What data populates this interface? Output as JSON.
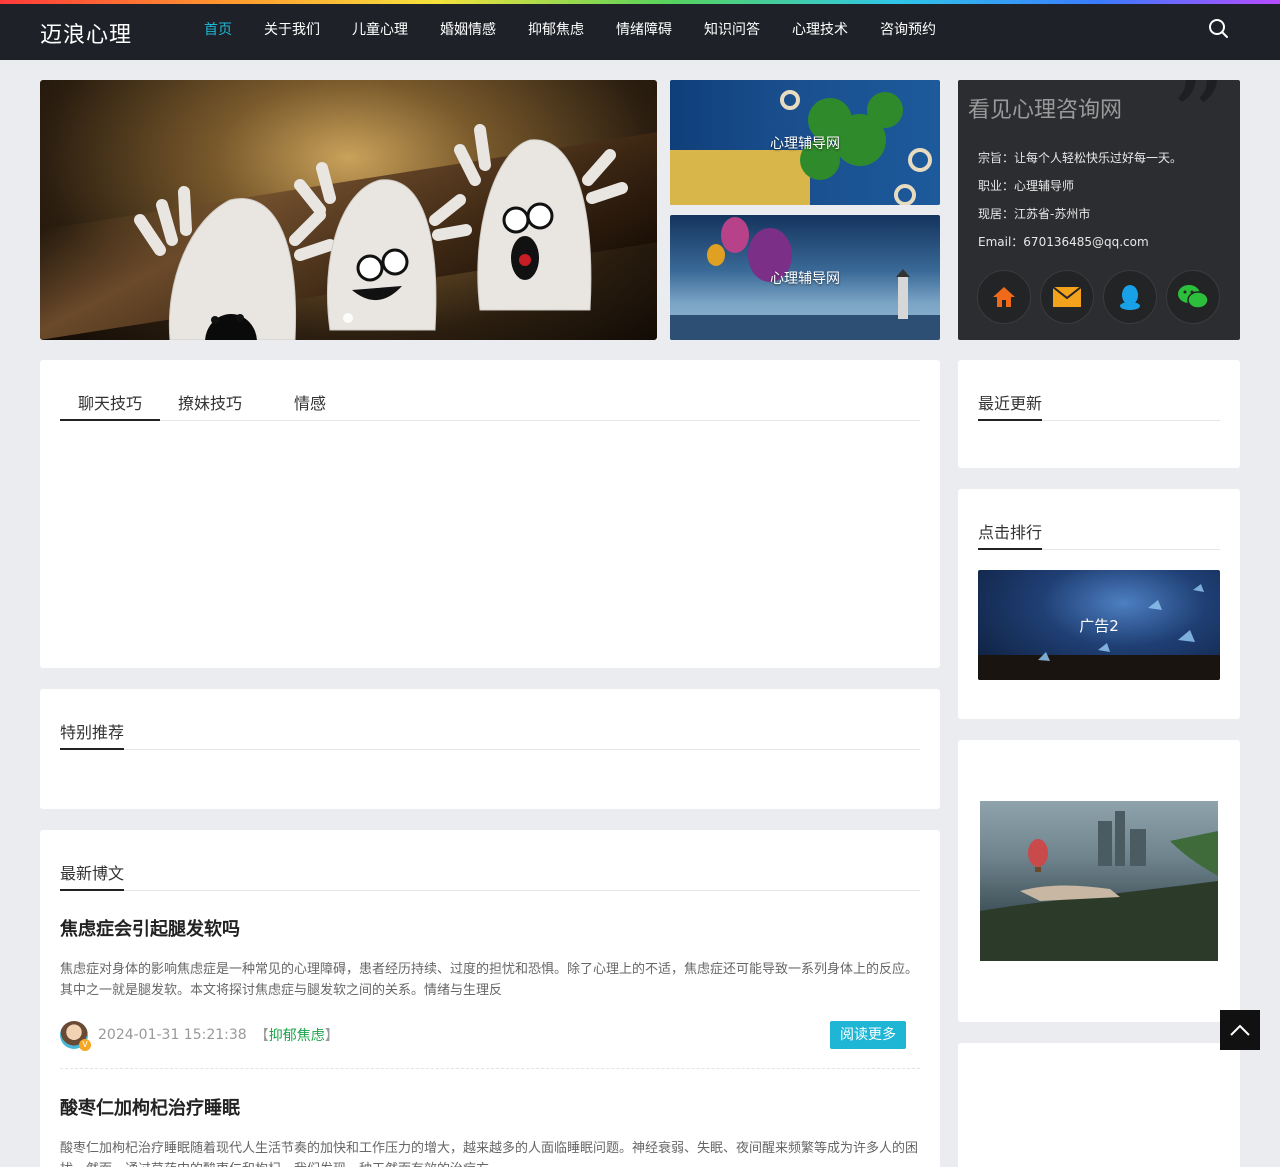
{
  "site": {
    "logo": "迈浪心理"
  },
  "nav": [
    "首页",
    "关于我们",
    "儿童心理",
    "婚姻情感",
    "抑郁焦虑",
    "情绪障碍",
    "知识问答",
    "心理技术",
    "咨询预约"
  ],
  "side_images": [
    "心理辅导网",
    "心理辅导网"
  ],
  "profile": {
    "title": "看见心理咨询网",
    "lines": [
      "宗旨：让每个人轻松快乐过好每一天。",
      "职业：心理辅导师",
      "现居：江苏省-苏州市",
      "Email：670136485@qq.com"
    ],
    "buttons": [
      "home-icon",
      "mail-icon",
      "qq-icon",
      "wechat-icon"
    ]
  },
  "tabs": [
    "聊天技巧",
    "撩妹技巧",
    "情感"
  ],
  "sections": {
    "recommend": "特别推荐",
    "latest": "最新博文",
    "recent": "最近更新",
    "rank": "点击排行"
  },
  "ad": {
    "caption": "广告2"
  },
  "posts": [
    {
      "title": "焦虑症会引起腿发软吗",
      "excerpt": "焦虑症对身体的影响焦虑症是一种常见的心理障碍，患者经历持续、过度的担忧和恐惧。除了心理上的不适，焦虑症还可能导致一系列身体上的反应。其中之一就是腿发软。本文将探讨焦虑症与腿发软之间的关系。情绪与生理反",
      "date": "2024-01-31 15:21:38",
      "category": "抑郁焦虑",
      "bracket_open": "【",
      "bracket_close": "】",
      "read_more": "阅读更多"
    },
    {
      "title": "酸枣仁加枸杞治疗睡眠",
      "excerpt": "酸枣仁加枸杞治疗睡眠随着现代人生活节奏的加快和工作压力的增大，越来越多的人面临睡眠问题。神经衰弱、失眠、夜间醒来频繁等成为许多人的困扰。然而，通过草药中的酸枣仁和枸杞，我们发现一种天然而有效的治疗方"
    }
  ],
  "colors": {
    "accent": "#1fb6d6",
    "header_bg": "#1e2228",
    "category": "#1ba34a"
  }
}
